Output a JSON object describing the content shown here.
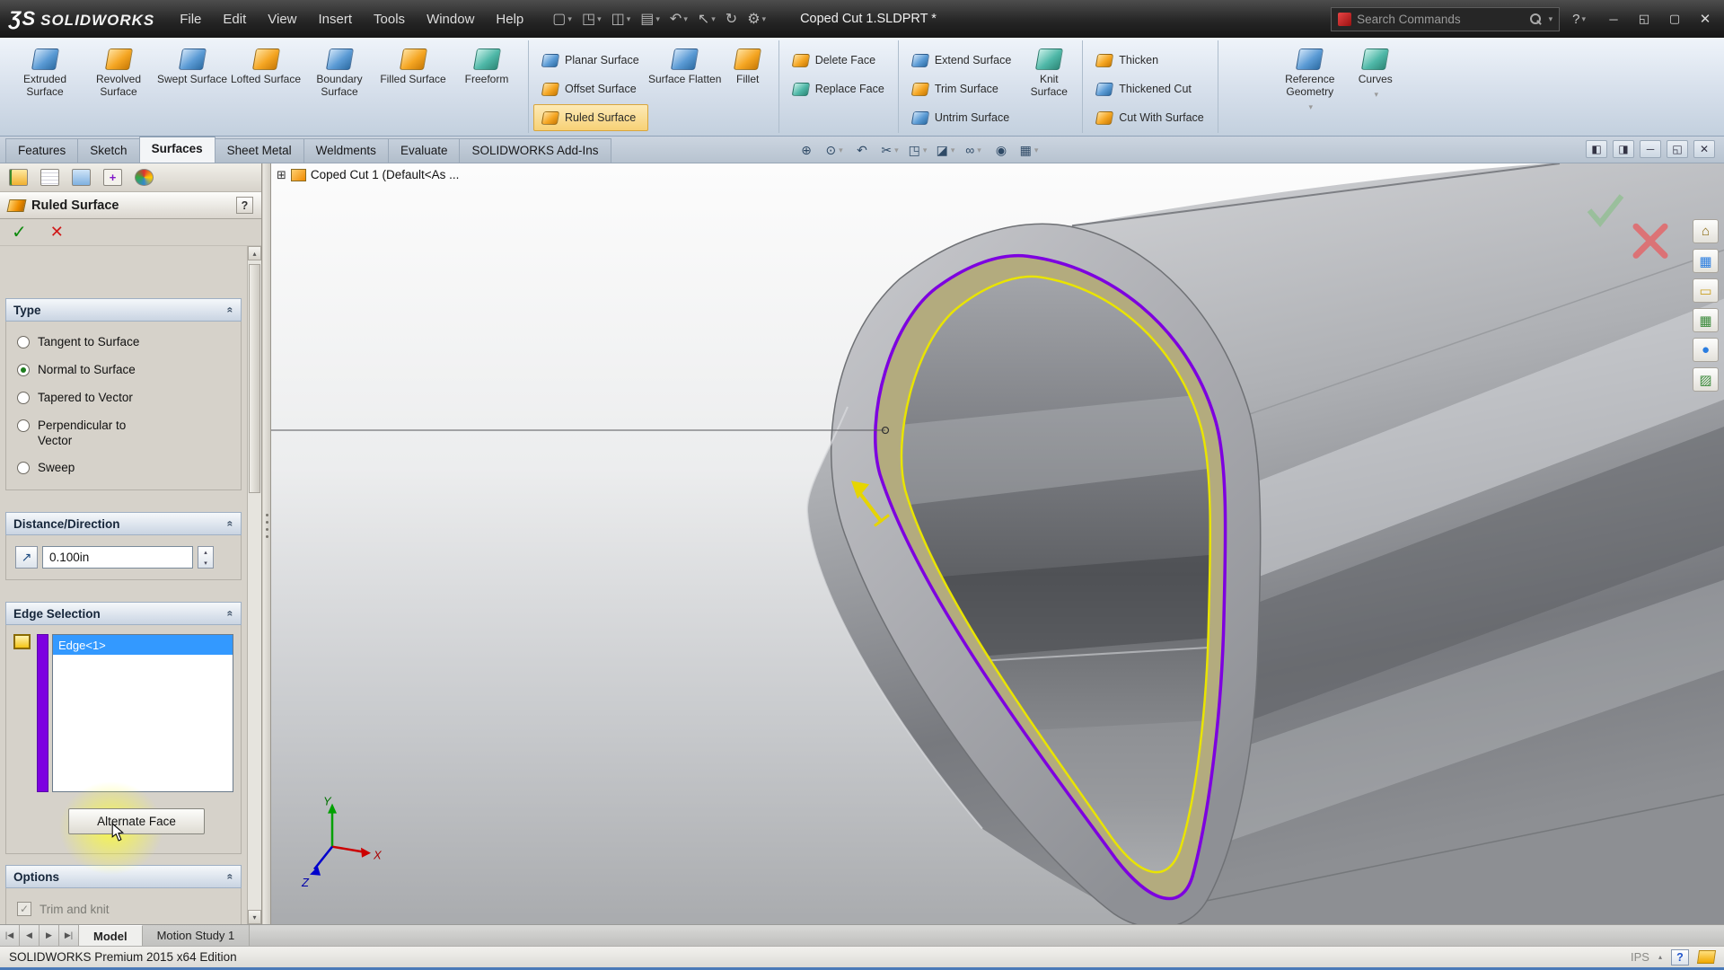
{
  "titlebar": {
    "logo_glyph": "ƷS",
    "logo_text": "SOLIDWORKS",
    "menus": [
      "File",
      "Edit",
      "View",
      "Insert",
      "Tools",
      "Window",
      "Help"
    ],
    "document_title": "Coped Cut 1.SLDPRT *",
    "search_placeholder": "Search Commands",
    "help": "?"
  },
  "icons": {
    "caret_down": "▾",
    "caret_up": "▴",
    "chevron_collapse": "«",
    "check": "✓",
    "cross": "✕",
    "minimize": "─",
    "restore": "◱",
    "maximize": "▢",
    "tile_h": "◧",
    "tile_v": "◨",
    "question": "?",
    "expand_box": "⊞",
    "new_doc": "▢",
    "open_doc": "◳",
    "save_doc": "◫",
    "print_doc": "▤",
    "undo": "↶",
    "pointer": "↖",
    "rebuild": "↻",
    "options_gear": "⚙",
    "zoom_fit": "⊕",
    "zoom_area": "⊙",
    "prev_view": "↶",
    "section": "✂",
    "orientation": "◳",
    "display_style": "◪",
    "hide_show": "∞",
    "appearance": "◉",
    "scene": "▦",
    "home": "⌂",
    "chart": "▦",
    "folder": "▭",
    "grid": "▦",
    "sphere": "●",
    "image": "▨",
    "direction": "↗",
    "nav_first": "|◀",
    "nav_prev": "◀",
    "nav_next": "▶",
    "nav_last": "▶|"
  },
  "ribbon": {
    "large": [
      "Extruded Surface",
      "Revolved Surface",
      "Swept Surface",
      "Lofted Surface",
      "Boundary Surface",
      "Filled Surface",
      "Freeform"
    ],
    "planar": [
      "Planar Surface",
      "Offset Surface",
      "Ruled Surface"
    ],
    "flatten": "Surface Flatten",
    "fillet": "Fillet",
    "faces": [
      "Delete Face",
      "Replace Face"
    ],
    "trim": [
      "Extend Surface",
      "Trim Surface",
      "Untrim Surface"
    ],
    "knit": "Knit Surface",
    "thicken": [
      "Thicken",
      "Thickened Cut",
      "Cut With Surface"
    ],
    "reference_geometry": "Reference Geometry",
    "curves": "Curves"
  },
  "tabs": [
    "Features",
    "Sketch",
    "Surfaces",
    "Sheet Metal",
    "Weldments",
    "Evaluate",
    "SOLIDWORKS Add-Ins"
  ],
  "feature_tree": {
    "root": "Coped Cut 1  (Default<As ..."
  },
  "property_manager": {
    "title": "Ruled Surface",
    "group_type": "Type",
    "type_options": [
      "Tangent to Surface",
      "Normal to Surface",
      "Tapered to Vector",
      "Perpendicular to Vector",
      "Sweep"
    ],
    "group_distance": "Distance/Direction",
    "distance_value": "0.100in",
    "group_edge": "Edge Selection",
    "edge_item": "Edge<1>",
    "alternate_face": "Alternate Face",
    "group_options": "Options",
    "trim_knit": "Trim and knit"
  },
  "triad": {
    "x": "X",
    "y": "Y",
    "z": "Z"
  },
  "bottom": {
    "tabs": [
      "Model",
      "Motion Study 1"
    ]
  },
  "status": {
    "text": "SOLIDWORKS Premium 2015 x64 Edition",
    "units": "IPS",
    "help": "?"
  },
  "colors": {
    "selection_purple": "#7d00e0",
    "preview_yellow": "#e9e400",
    "highlight_blue": "#3399ff"
  }
}
